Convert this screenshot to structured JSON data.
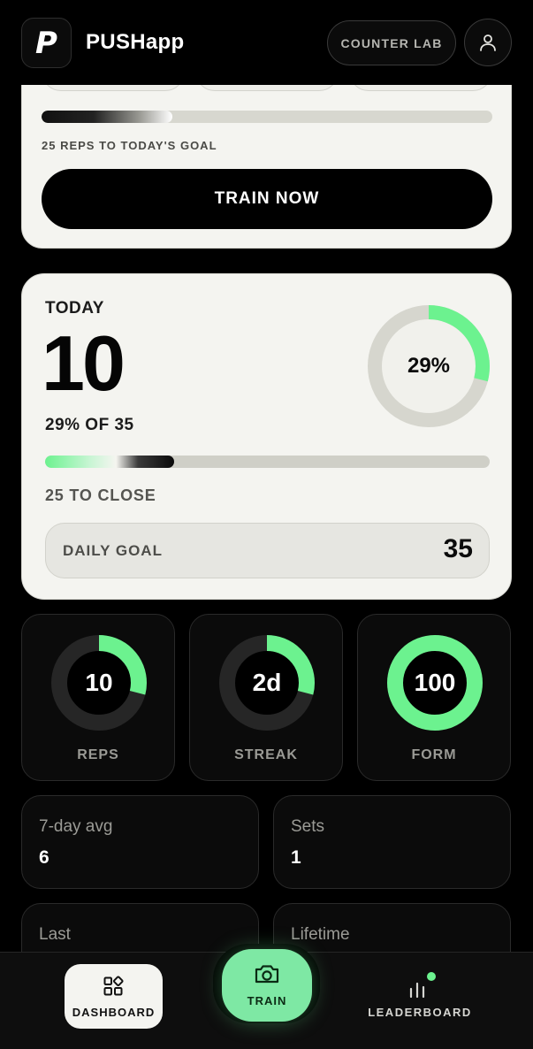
{
  "header": {
    "logo_glyph": "P",
    "app_name": "PUSHapp",
    "counter_lab_label": "COUNTER LAB",
    "profile_icon": "user-icon"
  },
  "top_card": {
    "progress": 0.29,
    "reps_to_goal_label": "25 REPS TO TODAY'S GOAL",
    "train_now_label": "TRAIN NOW"
  },
  "today": {
    "label": "TODAY",
    "value": "10",
    "percent_of_label": "29% OF 35",
    "ring_percent_label": "29%",
    "ring_progress": 0.29,
    "progress": 0.29,
    "to_close_label": "25 TO CLOSE",
    "daily_goal_label": "DAILY GOAL",
    "daily_goal_value": "35"
  },
  "tiles": [
    {
      "label": "REPS",
      "value": "10",
      "progress": 0.29
    },
    {
      "label": "STREAK",
      "value": "2d",
      "progress": 0.29
    },
    {
      "label": "FORM",
      "value": "100",
      "progress": 1.0
    }
  ],
  "metrics": [
    {
      "label": "7-day avg",
      "value": "6"
    },
    {
      "label": "Sets",
      "value": "1"
    },
    {
      "label": "Last",
      "value": ""
    },
    {
      "label": "Lifetime",
      "value": ""
    }
  ],
  "nav": {
    "dashboard_label": "DASHBOARD",
    "dashboard_icon": "grid-icon",
    "train_label": "TRAIN",
    "train_icon": "camera-icon",
    "leaderboard_label": "LEADERBOARD",
    "leaderboard_icon": "bar-chart-icon",
    "active": "DASHBOARD"
  },
  "colors": {
    "accent": "#6cf28f",
    "card_light": "#f4f4f0",
    "card_dark": "#0b0b0b",
    "background": "#000000"
  }
}
